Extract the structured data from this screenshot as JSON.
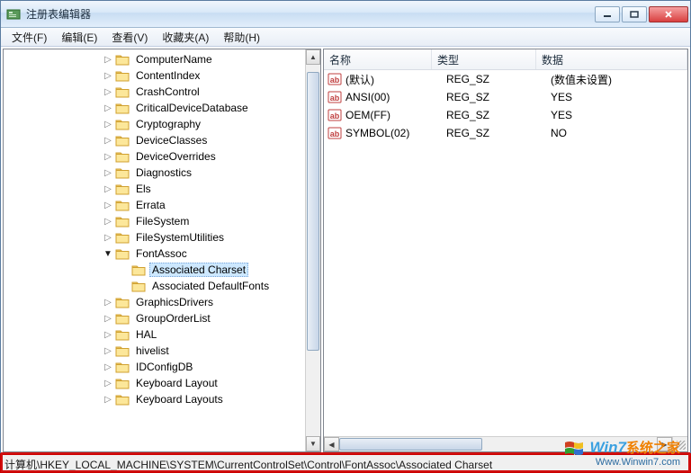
{
  "window": {
    "title": "注册表编辑器"
  },
  "menu": {
    "file": "文件(F)",
    "edit": "编辑(E)",
    "view": "查看(V)",
    "favorites": "收藏夹(A)",
    "help": "帮助(H)"
  },
  "tree": {
    "items": [
      "ComputerName",
      "ContentIndex",
      "CrashControl",
      "CriticalDeviceDatabase",
      "Cryptography",
      "DeviceClasses",
      "DeviceOverrides",
      "Diagnostics",
      "Els",
      "Errata",
      "FileSystem",
      "FileSystemUtilities"
    ],
    "fontassoc": "FontAssoc",
    "fontassoc_children": [
      "Associated Charset",
      "Associated DefaultFonts"
    ],
    "items_after": [
      "GraphicsDrivers",
      "GroupOrderList",
      "HAL",
      "hivelist",
      "IDConfigDB",
      "Keyboard Layout",
      "Keyboard Layouts"
    ]
  },
  "list": {
    "headers": {
      "name": "名称",
      "type": "类型",
      "data": "数据"
    },
    "rows": [
      {
        "name": "(默认)",
        "type": "REG_SZ",
        "data": "(数值未设置)"
      },
      {
        "name": "ANSI(00)",
        "type": "REG_SZ",
        "data": "YES"
      },
      {
        "name": "OEM(FF)",
        "type": "REG_SZ",
        "data": "YES"
      },
      {
        "name": "SYMBOL(02)",
        "type": "REG_SZ",
        "data": "NO"
      }
    ]
  },
  "statusbar": "计算机\\HKEY_LOCAL_MACHINE\\SYSTEM\\CurrentControlSet\\Control\\FontAssoc\\Associated Charset",
  "watermark": {
    "brand_en": "Win7",
    "brand_zh": "系统之家",
    "url": "Www.Winwin7.com"
  }
}
